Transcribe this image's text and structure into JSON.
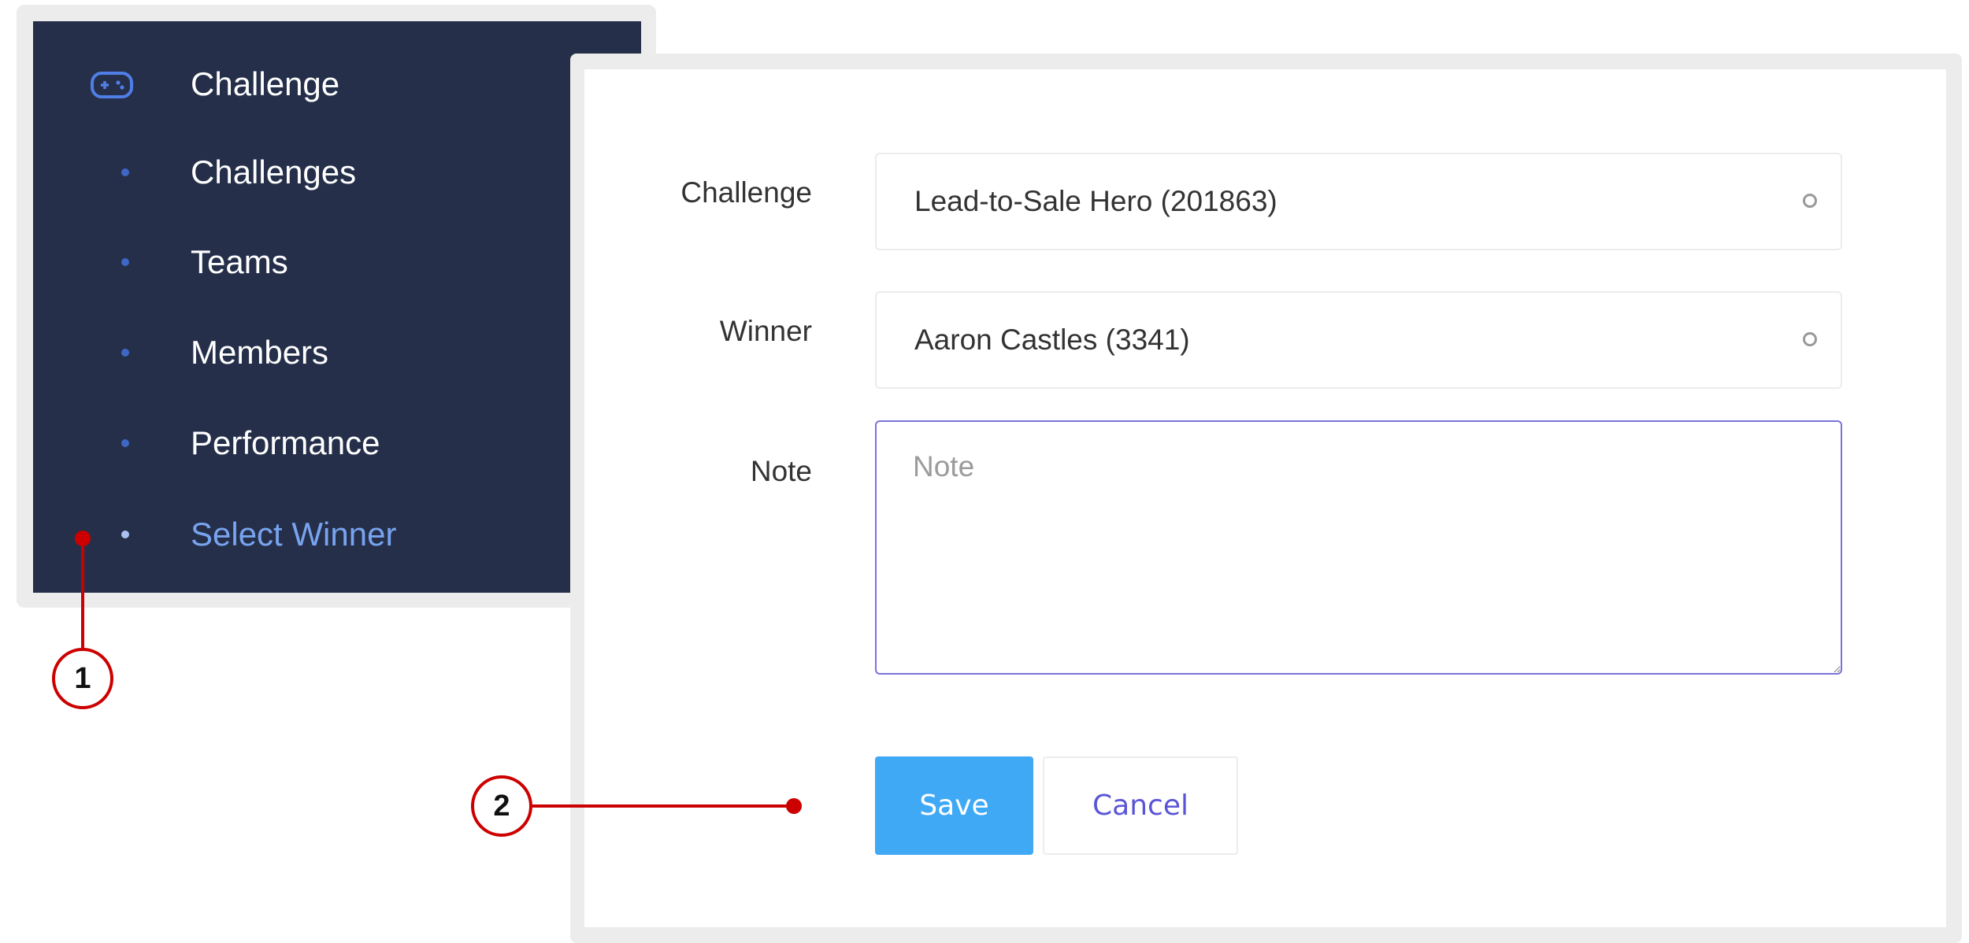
{
  "sidebar": {
    "header": {
      "label": "Challenge",
      "icon": "gamepad-icon"
    },
    "items": [
      {
        "label": "Challenges"
      },
      {
        "label": "Teams"
      },
      {
        "label": "Members"
      },
      {
        "label": "Performance"
      },
      {
        "label": "Select Winner",
        "active": true
      }
    ]
  },
  "form": {
    "challenge": {
      "label": "Challenge",
      "value": "Lead-to-Sale Hero (201863)"
    },
    "winner": {
      "label": "Winner",
      "value": "Aaron Castles (3341)"
    },
    "note": {
      "label": "Note",
      "placeholder": "Note",
      "value": ""
    },
    "save_label": "Save",
    "cancel_label": "Cancel"
  },
  "callouts": [
    "1",
    "2"
  ],
  "colors": {
    "sidebar_bg": "#252f4a",
    "active_item": "#78a4ef",
    "primary_button": "#3fa9f5",
    "cancel_text": "#5a55d6",
    "callout": "#cc0000"
  }
}
